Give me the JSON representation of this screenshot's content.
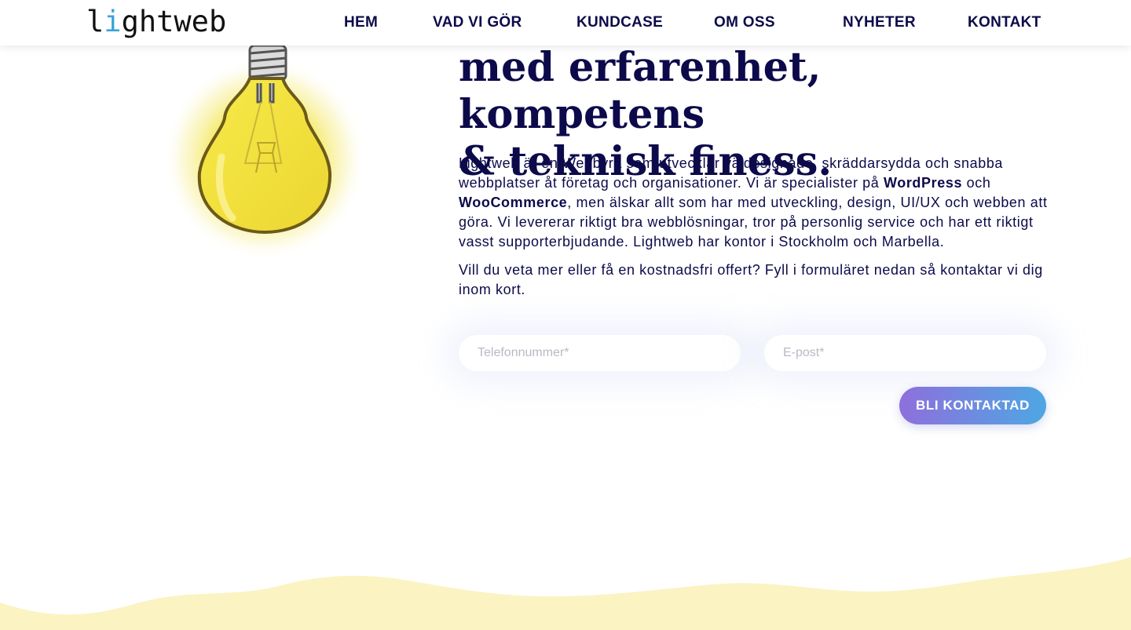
{
  "brand": {
    "logo_text": "lightweb",
    "accent_color": "#3ba3d8"
  },
  "nav": {
    "items": [
      {
        "label": "HEM"
      },
      {
        "label": "VAD VI GÖR"
      },
      {
        "label": "KUNDCASE"
      },
      {
        "label": "OM OSS"
      },
      {
        "label": "NYHETER"
      },
      {
        "label": "KONTAKT"
      }
    ]
  },
  "hero": {
    "headline_line1": "med erfarenhet, kompetens",
    "headline_line2": "& teknisk finess.",
    "intro_part1": "Lightweb är en Webbyrå som utvecklar väldesignade, skräddarsydda och snabba webbplatser åt företag och organisationer. Vi är specialister på ",
    "intro_bold1": "WordPress",
    "intro_part2": " och ",
    "intro_bold2": "WooCommerce",
    "intro_part3": ", men älskar allt som har med utveckling, design, UI/UX och webben att göra. Vi levererar riktigt bra webblösningar, tror på personlig service och har ett riktigt vasst supporterbjudande. Lightweb har kontor i Stockholm och Marbella.",
    "cta_text": "Vill du veta mer eller få en kostnadsfri offert? Fyll i formuläret nedan så kontaktar vi dig inom kort."
  },
  "form": {
    "phone_placeholder": "Telefonnummer*",
    "email_placeholder": "E-post*",
    "submit_label": "BLI KONTAKTAD",
    "button_gradient": [
      "#8e6fdc",
      "#4ea7e3"
    ]
  },
  "colors": {
    "text": "#0c0a4a",
    "wave": "#fbf3c2",
    "bulb": "#f3e23a"
  },
  "icons": {
    "bulb": "lightbulb-illustration"
  }
}
